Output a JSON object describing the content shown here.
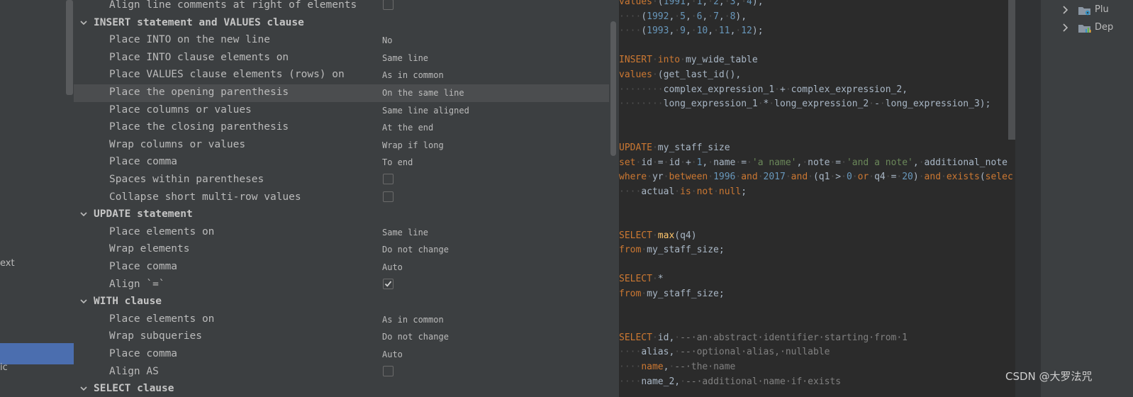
{
  "left_nav": {
    "items": [
      {
        "label": "ext"
      },
      {
        "label": "ic"
      }
    ]
  },
  "settings": {
    "rows": [
      {
        "type": "option",
        "label": "Align line comments at right of elements",
        "control": "checkbox",
        "checked": false
      },
      {
        "type": "section",
        "label": "INSERT statement and VALUES clause"
      },
      {
        "type": "option",
        "label": "Place INTO on the new line",
        "control": "select",
        "value": "No"
      },
      {
        "type": "option",
        "label": "Place INTO clause elements on",
        "control": "select",
        "value": "Same line"
      },
      {
        "type": "option",
        "label": "Place VALUES clause elements (rows) on",
        "control": "select",
        "value": "As in common"
      },
      {
        "type": "option",
        "label": "Place the opening parenthesis",
        "control": "select",
        "value": "On the same line",
        "highlight": true
      },
      {
        "type": "option",
        "label": "Place columns or values",
        "control": "select",
        "value": "Same line aligned"
      },
      {
        "type": "option",
        "label": "Place the closing parenthesis",
        "control": "select",
        "value": "At the end"
      },
      {
        "type": "option",
        "label": "Wrap columns or values",
        "control": "select",
        "value": "Wrap if long"
      },
      {
        "type": "option",
        "label": "Place comma",
        "control": "select",
        "value": "To end"
      },
      {
        "type": "option",
        "label": "Spaces within parentheses",
        "control": "checkbox",
        "checked": false
      },
      {
        "type": "option",
        "label": "Collapse short multi-row values",
        "control": "checkbox",
        "checked": false
      },
      {
        "type": "section",
        "label": "UPDATE statement"
      },
      {
        "type": "option",
        "label": "Place elements on",
        "control": "select",
        "value": "Same line"
      },
      {
        "type": "option",
        "label": "Wrap elements",
        "control": "select",
        "value": "Do not change"
      },
      {
        "type": "option",
        "label": "Place comma",
        "control": "select",
        "value": "Auto"
      },
      {
        "type": "option",
        "label": "Align `=`",
        "control": "checkbox",
        "checked": true
      },
      {
        "type": "section",
        "label": "WITH clause"
      },
      {
        "type": "option",
        "label": "Place elements on",
        "control": "select",
        "value": "As in common"
      },
      {
        "type": "option",
        "label": "Wrap subqueries",
        "control": "select",
        "value": "Do not change"
      },
      {
        "type": "option",
        "label": "Place comma",
        "control": "select",
        "value": "Auto"
      },
      {
        "type": "option",
        "label": "Align AS",
        "control": "checkbox",
        "checked": false
      },
      {
        "type": "section",
        "label": "SELECT clause"
      }
    ]
  },
  "editor": {
    "lines": [
      [
        [
          "kw",
          "values"
        ],
        [
          "ws",
          "·"
        ],
        [
          "t",
          "("
        ],
        [
          "num",
          "1991"
        ],
        [
          "t",
          ","
        ],
        [
          "ws",
          "·"
        ],
        [
          "num",
          "1"
        ],
        [
          "t",
          ","
        ],
        [
          "ws",
          "·"
        ],
        [
          "num",
          "2"
        ],
        [
          "t",
          ","
        ],
        [
          "ws",
          "·"
        ],
        [
          "num",
          "3"
        ],
        [
          "t",
          ","
        ],
        [
          "ws",
          "·"
        ],
        [
          "num",
          "4"
        ],
        [
          "t",
          "),"
        ]
      ],
      [
        [
          "ws",
          "····"
        ],
        [
          "t",
          "("
        ],
        [
          "num",
          "1992"
        ],
        [
          "t",
          ","
        ],
        [
          "ws",
          "·"
        ],
        [
          "num",
          "5"
        ],
        [
          "t",
          ","
        ],
        [
          "ws",
          "·"
        ],
        [
          "num",
          "6"
        ],
        [
          "t",
          ","
        ],
        [
          "ws",
          "·"
        ],
        [
          "num",
          "7"
        ],
        [
          "t",
          ","
        ],
        [
          "ws",
          "·"
        ],
        [
          "num",
          "8"
        ],
        [
          "t",
          "),"
        ]
      ],
      [
        [
          "ws",
          "····"
        ],
        [
          "t",
          "("
        ],
        [
          "num",
          "1993"
        ],
        [
          "t",
          ","
        ],
        [
          "ws",
          "·"
        ],
        [
          "num",
          "9"
        ],
        [
          "t",
          ","
        ],
        [
          "ws",
          "·"
        ],
        [
          "num",
          "10"
        ],
        [
          "t",
          ","
        ],
        [
          "ws",
          "·"
        ],
        [
          "num",
          "11"
        ],
        [
          "t",
          ","
        ],
        [
          "ws",
          "·"
        ],
        [
          "num",
          "12"
        ],
        [
          "t",
          ");"
        ]
      ],
      [],
      [
        [
          "kw",
          "INSERT"
        ],
        [
          "ws",
          "·"
        ],
        [
          "kw",
          "into"
        ],
        [
          "ws",
          "·"
        ],
        [
          "t",
          "my_wide_table"
        ]
      ],
      [
        [
          "kw",
          "values"
        ],
        [
          "ws",
          "·"
        ],
        [
          "t",
          "(get_last_id(),"
        ]
      ],
      [
        [
          "ws",
          "········"
        ],
        [
          "t",
          "complex_expression_1"
        ],
        [
          "ws",
          "·"
        ],
        [
          "t",
          "+"
        ],
        [
          "ws",
          "·"
        ],
        [
          "t",
          "complex_expression_2,"
        ]
      ],
      [
        [
          "ws",
          "········"
        ],
        [
          "t",
          "long_expression_1"
        ],
        [
          "ws",
          "·"
        ],
        [
          "t",
          "*"
        ],
        [
          "ws",
          "·"
        ],
        [
          "t",
          "long_expression_2"
        ],
        [
          "ws",
          "·"
        ],
        [
          "t",
          "-"
        ],
        [
          "ws",
          "·"
        ],
        [
          "t",
          "long_expression_3);"
        ]
      ],
      [],
      [],
      [
        [
          "kw",
          "UPDATE"
        ],
        [
          "ws",
          "·"
        ],
        [
          "t",
          "my_staff_size"
        ]
      ],
      [
        [
          "kw",
          "set"
        ],
        [
          "ws",
          "·"
        ],
        [
          "t",
          "id"
        ],
        [
          "ws",
          "·"
        ],
        [
          "t",
          "="
        ],
        [
          "ws",
          "·"
        ],
        [
          "t",
          "id"
        ],
        [
          "ws",
          "·"
        ],
        [
          "t",
          "+"
        ],
        [
          "ws",
          "·"
        ],
        [
          "num",
          "1"
        ],
        [
          "t",
          ","
        ],
        [
          "ws",
          "·"
        ],
        [
          "t",
          "name"
        ],
        [
          "ws",
          "·"
        ],
        [
          "t",
          "="
        ],
        [
          "ws",
          "·"
        ],
        [
          "str",
          "'a name'"
        ],
        [
          "t",
          ","
        ],
        [
          "ws",
          "·"
        ],
        [
          "t",
          "note"
        ],
        [
          "ws",
          "·"
        ],
        [
          "t",
          "="
        ],
        [
          "ws",
          "·"
        ],
        [
          "str",
          "'and a note'"
        ],
        [
          "t",
          ","
        ],
        [
          "ws",
          "·"
        ],
        [
          "t",
          "additional_note"
        ]
      ],
      [
        [
          "kw",
          "where"
        ],
        [
          "ws",
          "·"
        ],
        [
          "t",
          "yr"
        ],
        [
          "ws",
          "·"
        ],
        [
          "kw",
          "between"
        ],
        [
          "ws",
          "·"
        ],
        [
          "num",
          "1996"
        ],
        [
          "ws",
          "·"
        ],
        [
          "kw",
          "and"
        ],
        [
          "ws",
          "·"
        ],
        [
          "num",
          "2017"
        ],
        [
          "ws",
          "·"
        ],
        [
          "kw",
          "and"
        ],
        [
          "ws",
          "·"
        ],
        [
          "t",
          "(q1"
        ],
        [
          "ws",
          "·"
        ],
        [
          "t",
          ">"
        ],
        [
          "ws",
          "·"
        ],
        [
          "num",
          "0"
        ],
        [
          "ws",
          "·"
        ],
        [
          "kw",
          "or"
        ],
        [
          "ws",
          "·"
        ],
        [
          "t",
          "q4"
        ],
        [
          "ws",
          "·"
        ],
        [
          "t",
          "="
        ],
        [
          "ws",
          "·"
        ],
        [
          "num",
          "20"
        ],
        [
          "t",
          ")"
        ],
        [
          "ws",
          "·"
        ],
        [
          "kw",
          "and"
        ],
        [
          "ws",
          "·"
        ],
        [
          "kw",
          "exists"
        ],
        [
          "t",
          "("
        ],
        [
          "kw",
          "selec"
        ]
      ],
      [
        [
          "ws",
          "····"
        ],
        [
          "t",
          "actual"
        ],
        [
          "ws",
          "·"
        ],
        [
          "kw",
          "is"
        ],
        [
          "ws",
          "·"
        ],
        [
          "kw",
          "not"
        ],
        [
          "ws",
          "·"
        ],
        [
          "kw",
          "null"
        ],
        [
          "t",
          ";"
        ]
      ],
      [],
      [],
      [
        [
          "kw",
          "SELECT"
        ],
        [
          "ws",
          "·"
        ],
        [
          "fn",
          "max"
        ],
        [
          "t",
          "(q4)"
        ]
      ],
      [
        [
          "kw",
          "from"
        ],
        [
          "ws",
          "·"
        ],
        [
          "t",
          "my_staff_size;"
        ]
      ],
      [],
      [
        [
          "kw",
          "SELECT"
        ],
        [
          "ws",
          "·"
        ],
        [
          "t",
          "*"
        ]
      ],
      [
        [
          "kw",
          "from"
        ],
        [
          "ws",
          "·"
        ],
        [
          "t",
          "my_staff_size;"
        ]
      ],
      [],
      [],
      [
        [
          "kw",
          "SELECT"
        ],
        [
          "ws",
          "·"
        ],
        [
          "t",
          "id,"
        ],
        [
          "ws",
          "·"
        ],
        [
          "cmt",
          "--·an·abstract·identifier·starting·from·1"
        ]
      ],
      [
        [
          "ws",
          "····"
        ],
        [
          "t",
          "alias,"
        ],
        [
          "ws",
          "·"
        ],
        [
          "cmt",
          "--·optional·alias,·nullable"
        ]
      ],
      [
        [
          "ws",
          "····"
        ],
        [
          "kw",
          "name"
        ],
        [
          "t",
          ","
        ],
        [
          "ws",
          "·"
        ],
        [
          "cmt",
          "--·the·name"
        ]
      ],
      [
        [
          "ws",
          "····"
        ],
        [
          "t",
          "name_2,"
        ],
        [
          "ws",
          "·"
        ],
        [
          "cmt",
          "--·additional·name·if·exists"
        ]
      ]
    ]
  },
  "project_tree": {
    "items": [
      {
        "label": "Plu",
        "icon": "folder-settings-icon"
      },
      {
        "label": "Dep",
        "icon": "folder-chart-icon"
      }
    ]
  },
  "watermark": "CSDN @大罗法咒",
  "colors": {
    "keyword": "#cc7832",
    "number": "#6897bb",
    "string": "#6a8759",
    "comment": "#808080",
    "selection": "#4b6eaf"
  }
}
